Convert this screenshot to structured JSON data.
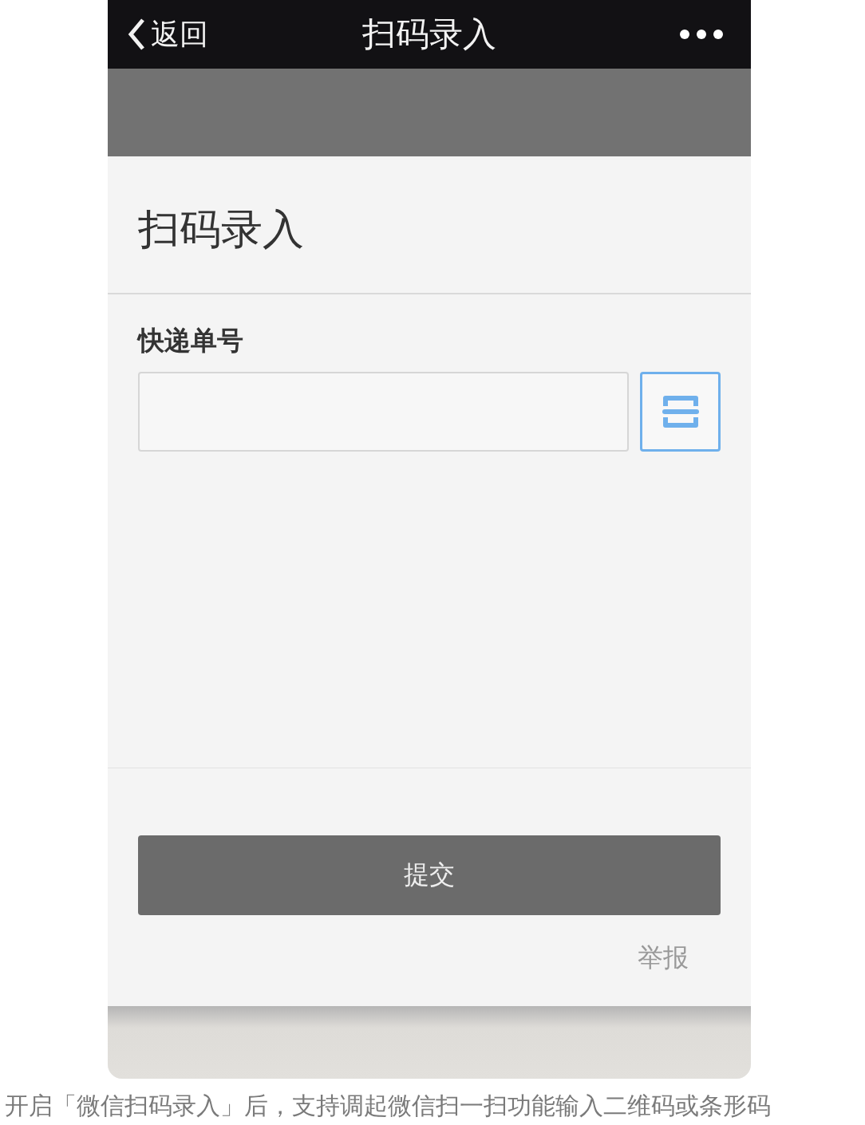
{
  "nav_bar": {
    "back_label": "返回",
    "title": "扫码录入"
  },
  "page_title": "扫码录入",
  "field": {
    "label": "快递单号"
  },
  "submit_button": "提交",
  "report_link": "举报",
  "caption": "开启「微信扫码录入」后，支持调起微信扫一扫功能输入二维码或条形码"
}
